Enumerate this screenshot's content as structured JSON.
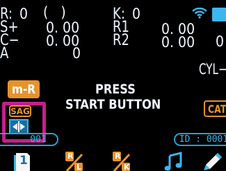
{
  "status_left": {
    "r": {
      "label": "R:",
      "value": "0",
      "paren": "(   )"
    },
    "s": {
      "label": "S+",
      "value": "0. 00"
    },
    "c": {
      "label": "C−",
      "value": "0. 00"
    },
    "a": {
      "label": "A",
      "value": "0"
    }
  },
  "status_right": {
    "k": {
      "label": "K:",
      "value": "0"
    },
    "r1": {
      "label": "R1",
      "value": "0. 00"
    },
    "r2": {
      "label": "R2",
      "value": "0. 00"
    },
    "right_edge_value": "0",
    "cyl_label": "CYL−"
  },
  "buttons": {
    "mr": "m-R",
    "cat": "CAT",
    "sag": "SAG"
  },
  "prompt": {
    "line1": "PRESS",
    "line2": "START BUTTON"
  },
  "id_left": "001",
  "id_right": "ID : 0001",
  "bottom_icons": [
    {
      "icon": "page-1-icon",
      "text": "1"
    },
    {
      "icon": "r-l-icon",
      "top": "R",
      "bottom": "L"
    },
    {
      "icon": "r-k-icon",
      "top": "R",
      "bottom": "K"
    },
    {
      "icon": "music-note-icon"
    },
    {
      "icon": "pencil-icon"
    }
  ],
  "colors": {
    "accent_orange": "#e8922a",
    "accent_blue": "#35b8f2",
    "highlight_magenta": "#c81e8c",
    "background": "#000000"
  }
}
